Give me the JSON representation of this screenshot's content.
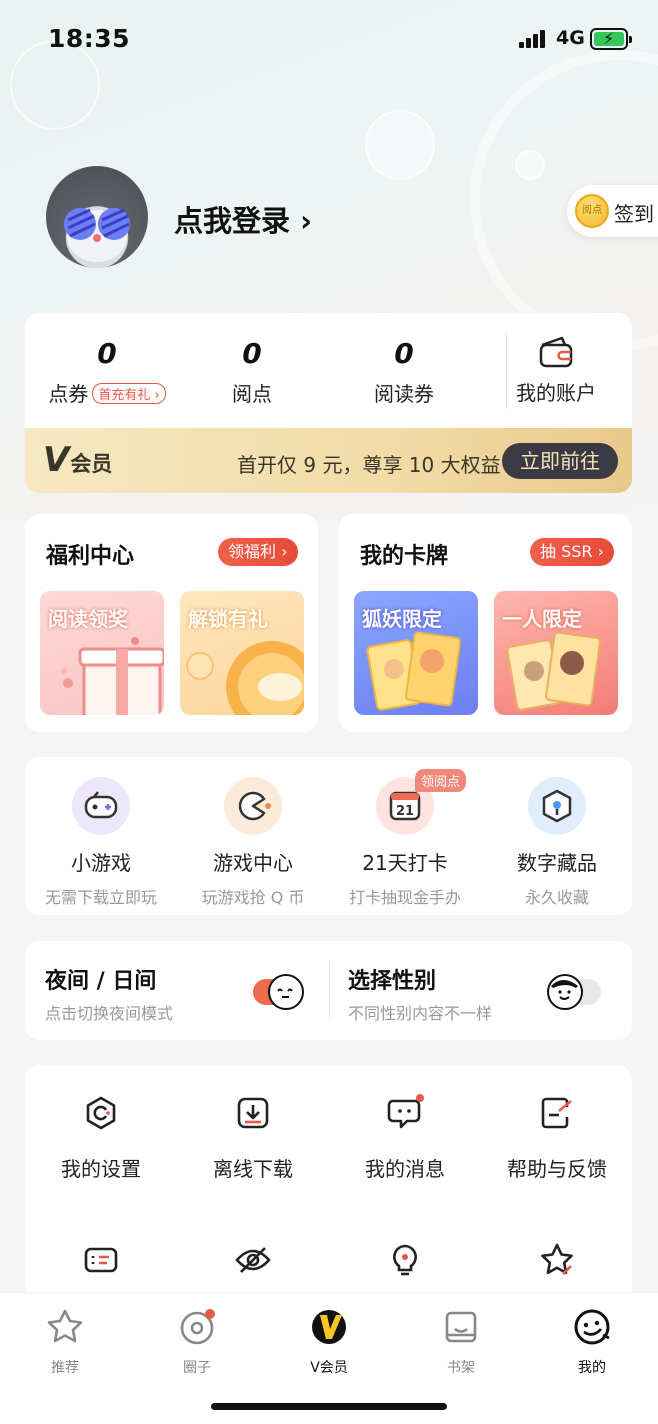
{
  "status_bar": {
    "time": "18:35",
    "network": "4G"
  },
  "profile": {
    "login_text": "点我登录 ›",
    "signin_label": "签到",
    "coin_text": "阅点"
  },
  "stats": [
    {
      "value": "0",
      "label": "点券",
      "tag": "首充有礼 ›"
    },
    {
      "value": "0",
      "label": "阅点"
    },
    {
      "value": "0",
      "label": "阅读券"
    }
  ],
  "account": {
    "label": "我的账户"
  },
  "vip_banner": {
    "logo": "V",
    "logo_sub": "会员",
    "desc": "首开仅 9 元，尊享 10 大权益",
    "button": "立即前往"
  },
  "welfare": {
    "title": "福利中心",
    "pill": "领福利 ›",
    "tiles": [
      {
        "title": "阅读领奖"
      },
      {
        "title": "解锁有礼"
      }
    ]
  },
  "cards": {
    "title": "我的卡牌",
    "pill": "抽 SSR ›",
    "tiles": [
      {
        "title": "狐妖限定"
      },
      {
        "title": "一人限定"
      }
    ]
  },
  "features": [
    {
      "name": "小游戏",
      "sub": "无需下载立即玩",
      "icon": "gamepad-icon"
    },
    {
      "name": "游戏中心",
      "sub": "玩游戏抢 Q 币",
      "icon": "pacman-icon"
    },
    {
      "name": "21天打卡",
      "sub": "打卡抽现金手办",
      "icon": "calendar-21-icon",
      "badge": "领阅点",
      "day": "21"
    },
    {
      "name": "数字藏品",
      "sub": "永久收藏",
      "icon": "cube-icon"
    }
  ],
  "toggles": [
    {
      "title": "夜间 / 日间",
      "sub": "点击切换夜间模式",
      "on": true
    },
    {
      "title": "选择性别",
      "sub": "不同性别内容不一样",
      "on": false
    }
  ],
  "menu": [
    {
      "name": "我的设置",
      "icon": "settings-icon"
    },
    {
      "name": "离线下载",
      "icon": "download-icon"
    },
    {
      "name": "我的消息",
      "icon": "message-icon",
      "dot": true
    },
    {
      "name": "帮助与反馈",
      "icon": "feedback-icon"
    },
    {
      "icon": "ticket-icon"
    },
    {
      "icon": "eye-off-icon"
    },
    {
      "icon": "lightbulb-icon"
    },
    {
      "icon": "star-edit-icon"
    }
  ],
  "tabbar": [
    {
      "label": "推荐",
      "icon": "star-icon"
    },
    {
      "label": "圈子",
      "icon": "circle-icon",
      "dot": true
    },
    {
      "label": "V会员",
      "icon": "vip-icon",
      "active": true
    },
    {
      "label": "书架",
      "icon": "bookshelf-icon"
    },
    {
      "label": "我的",
      "icon": "profile-face-icon",
      "active": true
    }
  ],
  "colors": {
    "accent": "#e8574a",
    "vip_gold": "#f2dca7",
    "vip_dark": "#3b3a44",
    "switch_on": "#ef6a4e"
  }
}
